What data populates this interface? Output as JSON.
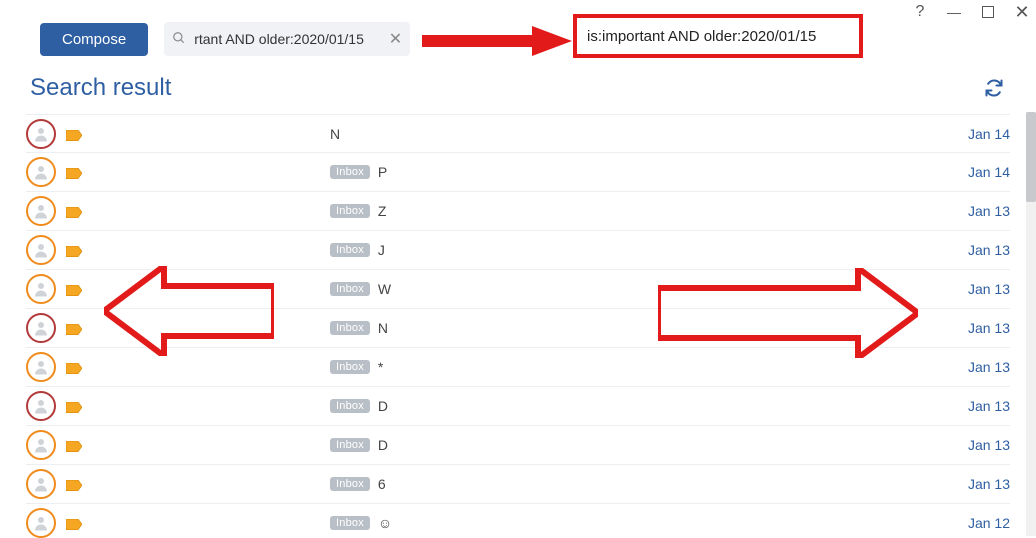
{
  "window": {
    "help": "?",
    "minimize": "—",
    "close": "✕"
  },
  "toolbar": {
    "compose_label": "Compose",
    "search_value": "rtant AND older:2020/01/15",
    "search_placeholder": ""
  },
  "page": {
    "title": "Search result"
  },
  "annotation": {
    "full_query": "is:important AND older:2020/01/15"
  },
  "inbox_badge": "Inbox",
  "rows": [
    {
      "avatar_color": "red",
      "has_badge": false,
      "subject": "N",
      "date": "Jan 14"
    },
    {
      "avatar_color": "orange",
      "has_badge": true,
      "subject": "P",
      "date": "Jan 14"
    },
    {
      "avatar_color": "orange",
      "has_badge": true,
      "subject": "Z",
      "date": "Jan 13"
    },
    {
      "avatar_color": "orange",
      "has_badge": true,
      "subject": "J",
      "date": "Jan 13"
    },
    {
      "avatar_color": "orange",
      "has_badge": true,
      "subject": "W",
      "date": "Jan 13"
    },
    {
      "avatar_color": "red",
      "has_badge": true,
      "subject": "N",
      "date": "Jan 13"
    },
    {
      "avatar_color": "orange",
      "has_badge": true,
      "subject": "*",
      "date": "Jan 13"
    },
    {
      "avatar_color": "red",
      "has_badge": true,
      "subject": "D",
      "date": "Jan 13"
    },
    {
      "avatar_color": "orange",
      "has_badge": true,
      "subject": "D",
      "date": "Jan 13"
    },
    {
      "avatar_color": "orange",
      "has_badge": true,
      "subject": "6",
      "date": "Jan 13"
    },
    {
      "avatar_color": "orange",
      "has_badge": true,
      "subject": "☺",
      "date": "Jan 12"
    }
  ]
}
